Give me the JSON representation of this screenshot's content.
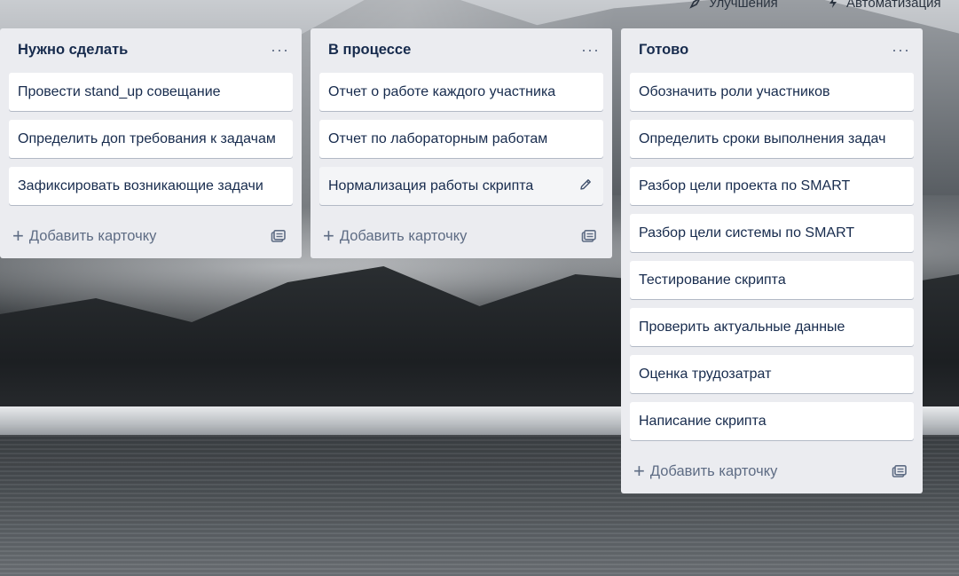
{
  "header": {
    "improvements_label": "Улучшения",
    "automation_label": "Автоматизация"
  },
  "lists": [
    {
      "title": "Нужно сделать",
      "menu_icon": "more-horizontal-icon",
      "cards": [
        "Провести stand_up совещание",
        "Определить доп требования к задачам",
        "Зафиксировать возникающие задачи"
      ],
      "add_card_label": "Добавить карточку"
    },
    {
      "title": "В процессе",
      "menu_icon": "more-horizontal-icon",
      "cards": [
        "Отчет о работе каждого участника",
        "Отчет по лабораторным работам",
        "Нормализация работы скрипта"
      ],
      "add_card_label": "Добавить карточку"
    },
    {
      "title": "Готово",
      "menu_icon": "more-horizontal-icon",
      "cards": [
        "Обозначить роли участников",
        "Определить сроки выполнения задач",
        "Разбор цели проекта по SMART",
        "Разбор цели системы по SMART",
        "Тестирование скрипта",
        "Проверить актуальные данные",
        "Оценка трудозатрат",
        "Написание скрипта"
      ],
      "add_card_label": "Добавить карточку"
    }
  ],
  "colors": {
    "list_bg": "#ebecf0",
    "card_bg": "#ffffff",
    "text": "#172b4d",
    "muted": "#5e6c84"
  }
}
